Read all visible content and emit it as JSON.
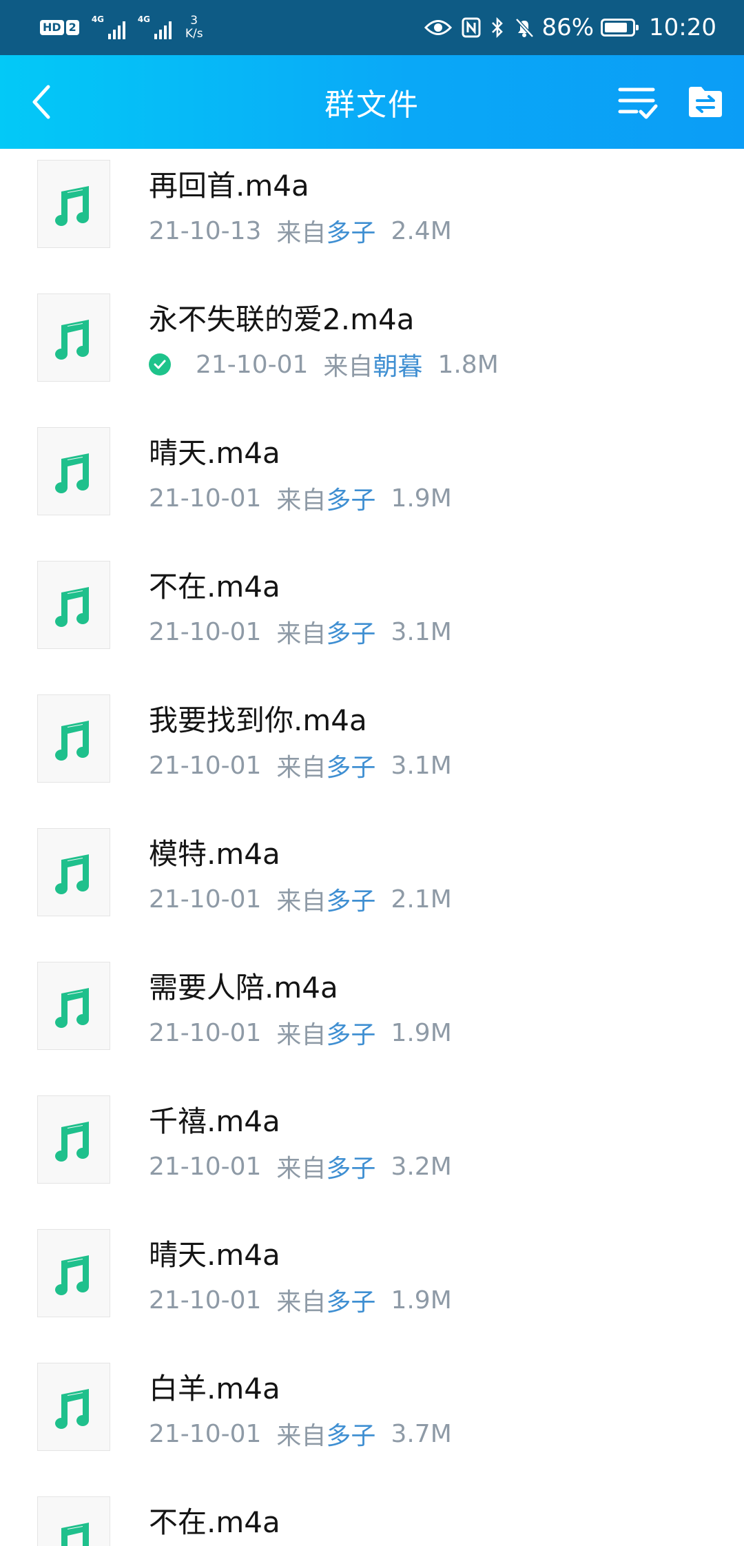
{
  "status_bar": {
    "hd_label": "HD",
    "sim_label": "2",
    "signal_1_label": "4G",
    "signal_2_label": "4G",
    "net_speed_value": "3",
    "net_speed_unit": "K/s",
    "battery_percent": "86%",
    "battery_level": 0.86,
    "time": "10:20"
  },
  "header": {
    "title": "群文件",
    "background_start": "#03c9f7",
    "background_end": "#0b9df6"
  },
  "colors": {
    "music_icon": "#1fc08c",
    "sender_link": "#3f8fd2",
    "meta_text": "#8e9aa6"
  },
  "files": [
    {
      "name": "再回首.m4a",
      "date": "21-10-13",
      "from_label": "来自",
      "sender": "多子",
      "size": "2.4M",
      "downloaded": false,
      "icon": "music-note-icon"
    },
    {
      "name": "永不失联的爱2.m4a",
      "date": "21-10-01",
      "from_label": "来自",
      "sender": "朝暮",
      "size": "1.8M",
      "downloaded": true,
      "icon": "music-note-icon"
    },
    {
      "name": "晴天.m4a",
      "date": "21-10-01",
      "from_label": "来自",
      "sender": "多子",
      "size": "1.9M",
      "downloaded": false,
      "icon": "music-note-icon"
    },
    {
      "name": "不在.m4a",
      "date": "21-10-01",
      "from_label": "来自",
      "sender": "多子",
      "size": "3.1M",
      "downloaded": false,
      "icon": "music-note-icon"
    },
    {
      "name": "我要找到你.m4a",
      "date": "21-10-01",
      "from_label": "来自",
      "sender": "多子",
      "size": "3.1M",
      "downloaded": false,
      "icon": "music-note-icon"
    },
    {
      "name": "模特.m4a",
      "date": "21-10-01",
      "from_label": "来自",
      "sender": "多子",
      "size": "2.1M",
      "downloaded": false,
      "icon": "music-note-icon"
    },
    {
      "name": "需要人陪.m4a",
      "date": "21-10-01",
      "from_label": "来自",
      "sender": "多子",
      "size": "1.9M",
      "downloaded": false,
      "icon": "music-note-icon"
    },
    {
      "name": "千禧.m4a",
      "date": "21-10-01",
      "from_label": "来自",
      "sender": "多子",
      "size": "3.2M",
      "downloaded": false,
      "icon": "music-note-icon"
    },
    {
      "name": "晴天.m4a",
      "date": "21-10-01",
      "from_label": "来自",
      "sender": "多子",
      "size": "1.9M",
      "downloaded": false,
      "icon": "music-note-icon"
    },
    {
      "name": "白羊.m4a",
      "date": "21-10-01",
      "from_label": "来自",
      "sender": "多子",
      "size": "3.7M",
      "downloaded": false,
      "icon": "music-note-icon"
    },
    {
      "name": "不在.m4a",
      "date": "",
      "from_label": "",
      "sender": "",
      "size": "",
      "downloaded": false,
      "icon": "music-note-icon"
    }
  ]
}
